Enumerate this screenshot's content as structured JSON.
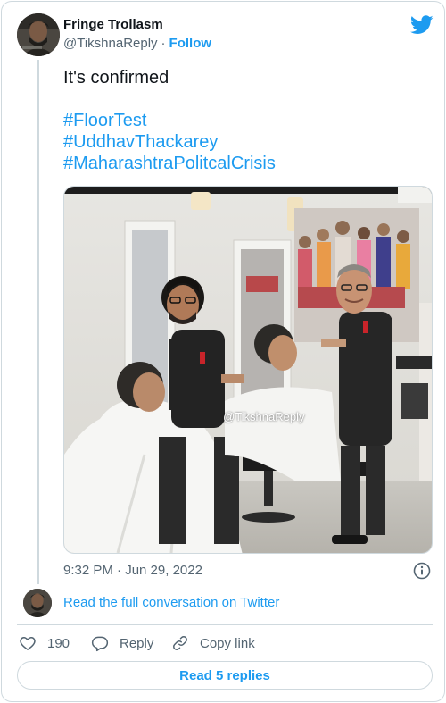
{
  "author": {
    "display_name": "Fringe Trollasm",
    "handle": "@TikshnaReply",
    "separator": "·",
    "follow_label": "Follow"
  },
  "brand_icon": "twitter-bird-icon",
  "tweet": {
    "text": "It's confirmed",
    "hashtags": [
      "#FloorTest",
      "#UddhavThackarey",
      "#MaharashtraPolitcalCrisis"
    ]
  },
  "media": {
    "watermark": "@TikshnaReply"
  },
  "timestamp": "9:32 PM · Jun 29, 2022",
  "read_conversation_label": "Read the full conversation on Twitter",
  "actions": {
    "like_count": "190",
    "reply_label": "Reply",
    "copy_link_label": "Copy link"
  },
  "read_replies_label": "Read 5 replies",
  "colors": {
    "accent": "#1d9bf0",
    "text": "#0f1419",
    "muted": "#536471",
    "border": "#cfd9de"
  }
}
